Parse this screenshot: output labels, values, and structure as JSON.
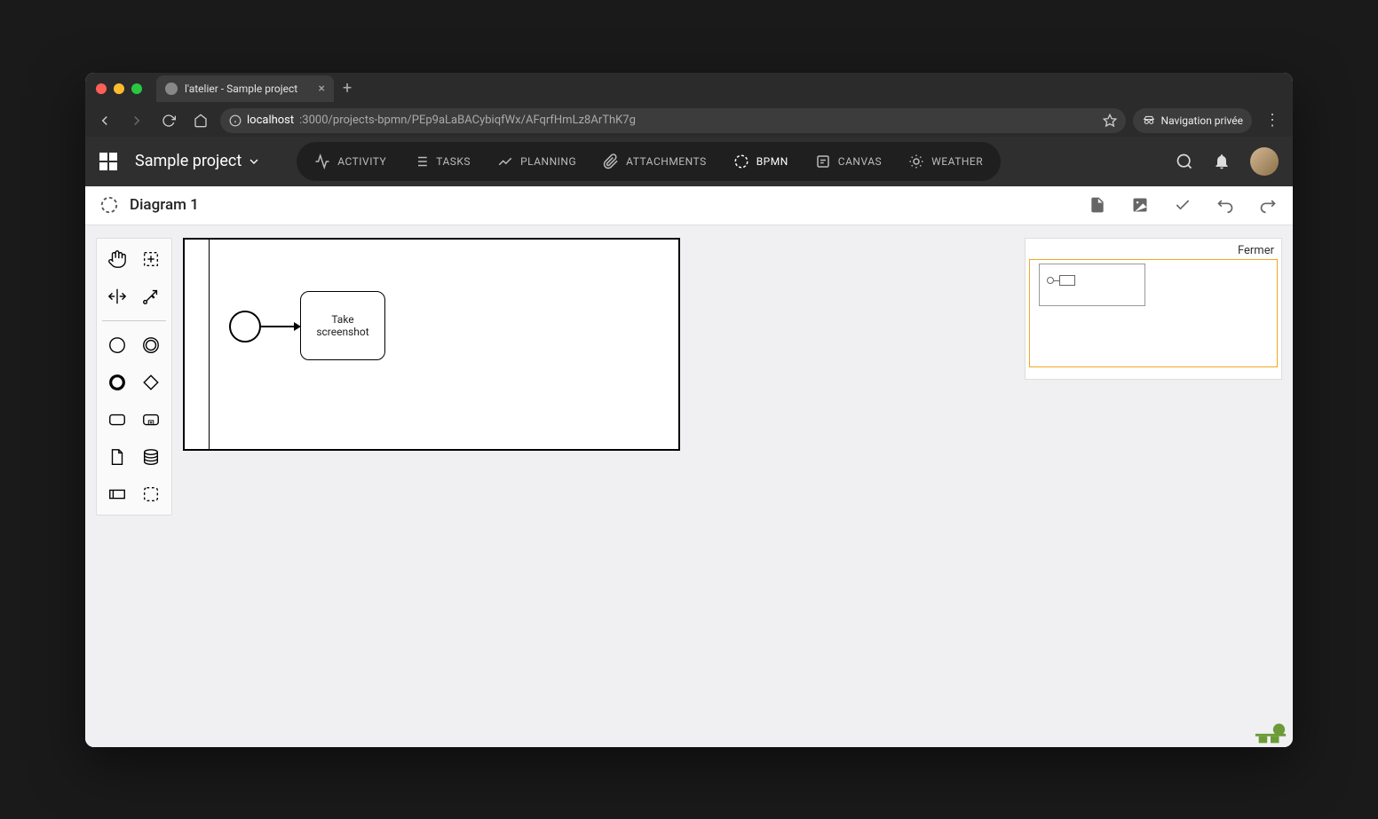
{
  "browser": {
    "tab_title": "l'atelier - Sample project",
    "url_host": "localhost",
    "url_port_path": ":3000/projects-bpmn/PEp9aLaBACybiqfWx/AFqrfHmLz8ArThK7g",
    "private_label": "Navigation privée"
  },
  "header": {
    "project_name": "Sample project",
    "nav": [
      {
        "label": "ACTIVITY",
        "icon": "activity-icon"
      },
      {
        "label": "TASKS",
        "icon": "list-icon"
      },
      {
        "label": "PLANNING",
        "icon": "timeline-icon"
      },
      {
        "label": "ATTACHMENTS",
        "icon": "attachment-icon"
      },
      {
        "label": "BPMN",
        "icon": "bpmn-icon",
        "active": true
      },
      {
        "label": "CANVAS",
        "icon": "note-icon"
      },
      {
        "label": "WEATHER",
        "icon": "weather-icon"
      }
    ]
  },
  "subheader": {
    "diagram_name": "Diagram 1"
  },
  "palette": {
    "tools": [
      "hand-tool",
      "lasso-tool",
      "space-tool",
      "global-connect-tool",
      "start-event-tool",
      "intermediate-event-tool",
      "end-event-tool",
      "gateway-tool",
      "task-tool",
      "subprocess-tool",
      "data-object-tool",
      "data-store-tool",
      "participant-tool",
      "group-tool"
    ]
  },
  "diagram": {
    "task_label": "Take screenshot"
  },
  "minimap": {
    "close_label": "Fermer"
  }
}
